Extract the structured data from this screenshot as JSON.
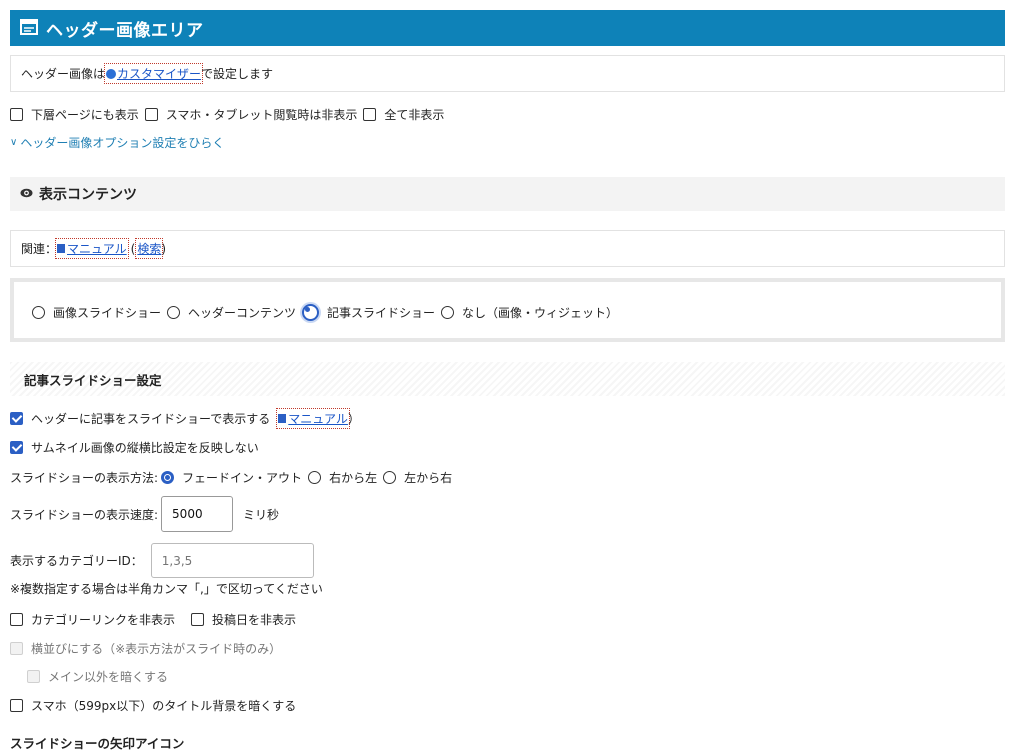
{
  "header_area": {
    "title": "ヘッダー画像エリア",
    "note_prefix": "ヘッダー画像は",
    "customizer_link": "カスタマイザー",
    "note_suffix": "で設定します",
    "checkboxes": [
      {
        "label": "下層ページにも表示",
        "checked": false
      },
      {
        "label": "スマホ・タブレット閲覧時は非表示",
        "checked": false
      },
      {
        "label": "全て非表示",
        "checked": false
      }
    ],
    "options_toggle": "ヘッダー画像オプション設定をひらく"
  },
  "display_content": {
    "title": "表示コンテンツ",
    "related_label": "関連：",
    "manual_link": "マニュアル",
    "search_link": "検索",
    "radios": [
      {
        "label": "画像スライドショー",
        "selected": false
      },
      {
        "label": "ヘッダーコンテンツ",
        "selected": false
      },
      {
        "label": "記事スライドショー",
        "selected": true
      },
      {
        "label": "なし（画像・ウィジェット）",
        "selected": false
      }
    ]
  },
  "slideshow_settings": {
    "title": "記事スライドショー設定",
    "show_in_header": {
      "label": "ヘッダーに記事をスライドショーで表示する",
      "checked": true,
      "manual_link": "マニュアル",
      "close_paren": "）"
    },
    "no_aspect": {
      "label": "サムネイル画像の縦横比設定を反映しない",
      "checked": true
    },
    "method_label": "スライドショーの表示方法:",
    "methods": [
      {
        "label": "フェードイン・アウト",
        "selected": true
      },
      {
        "label": "右から左",
        "selected": false
      },
      {
        "label": "左から右",
        "selected": false
      }
    ],
    "speed_label": "スライドショーの表示速度:",
    "speed_value": "5000",
    "speed_unit": "ミリ秒",
    "category_label": "表示するカテゴリーID：",
    "category_placeholder": "1,3,5",
    "category_note": "※複数指定する場合は半角カンマ「,」で区切ってください",
    "hide_category_link": {
      "label": "カテゴリーリンクを非表示",
      "checked": false
    },
    "hide_post_date": {
      "label": "投稿日を非表示",
      "checked": false
    },
    "side_by_side": {
      "label": "横並びにする（※表示方法がスライド時のみ）",
      "checked": false,
      "disabled": true
    },
    "darken_non_main": {
      "label": "メイン以外を暗くする",
      "checked": false,
      "disabled": true
    },
    "darken_title_bg": {
      "label": "スマホ（599px以下）のタイトル背景を暗くする",
      "checked": false
    },
    "arrow_icon_heading": "スライドショーの矢印アイコン"
  }
}
